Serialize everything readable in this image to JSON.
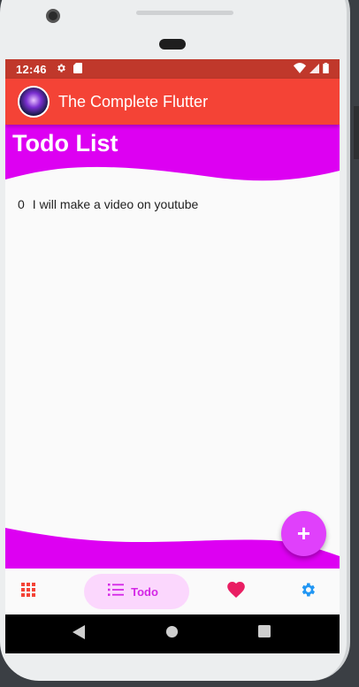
{
  "status_bar": {
    "time": "12:46",
    "left_icons": [
      "gear-icon",
      "sd-card-icon"
    ],
    "right_icons": [
      "wifi-icon",
      "signal-icon",
      "battery-icon"
    ]
  },
  "app_bar": {
    "title": "The Complete Flutter",
    "avatar_icon": "app-logo"
  },
  "page": {
    "title": "Todo List",
    "header_color": "#dd00f2"
  },
  "todos": [
    {
      "index": "0",
      "text": "I will make a video on youtube"
    }
  ],
  "fab": {
    "label": "+",
    "color": "#e040fb"
  },
  "bottom_nav": {
    "items": [
      {
        "icon": "apps-grid-icon",
        "label": "",
        "color": "#f44336",
        "selected": false
      },
      {
        "icon": "list-icon",
        "label": "Todo",
        "color": "#d427e6",
        "selected": true
      },
      {
        "icon": "heart-icon",
        "label": "",
        "color": "#e91e63",
        "selected": false
      },
      {
        "icon": "gear-icon",
        "label": "",
        "color": "#2196f3",
        "selected": false
      }
    ]
  },
  "system_nav": [
    "back-icon",
    "home-icon",
    "recents-icon"
  ],
  "colors": {
    "status_bar": "#c0382b",
    "app_bar": "#f44336",
    "accent": "#dd00f2",
    "nav_pill": "#fbd7fd"
  }
}
